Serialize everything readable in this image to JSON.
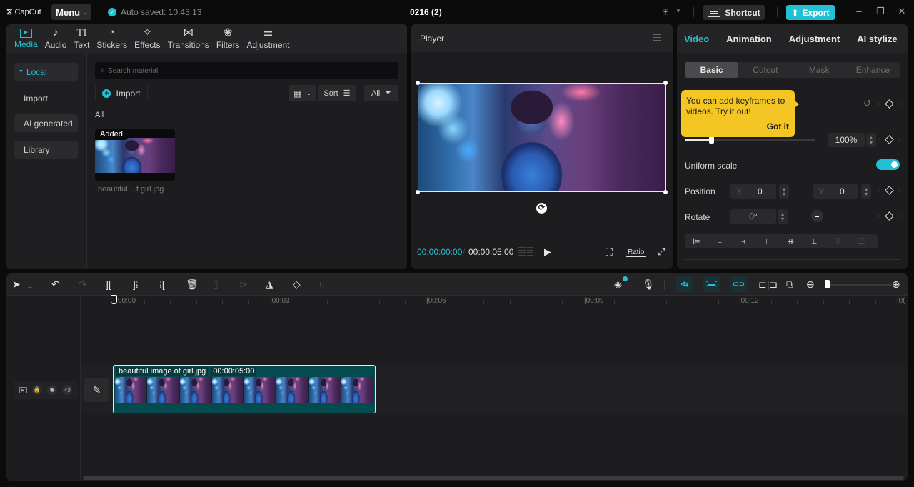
{
  "titlebar": {
    "app_name": "CapCut",
    "menu_label": "Menu",
    "auto_saved": "Auto saved: 10:43:13",
    "project_title": "0216 (2)",
    "shortcut_label": "Shortcut",
    "export_label": "Export",
    "icons": {
      "logo": "capcut-logo-icon",
      "saved": "check-circle-icon",
      "layout": "layout-icon",
      "keyboard": "keyboard-icon",
      "export": "upload-icon",
      "minimize": "minimize-icon",
      "maximize": "restore-icon",
      "close": "close-icon"
    }
  },
  "media": {
    "tabs": [
      {
        "label": "Media",
        "icon": "▶",
        "active": true
      },
      {
        "label": "Audio",
        "icon": "♪"
      },
      {
        "label": "Text",
        "icon": "TI"
      },
      {
        "label": "Stickers",
        "icon": "◔"
      },
      {
        "label": "Effects",
        "icon": "✧"
      },
      {
        "label": "Transitions",
        "icon": "⋈"
      },
      {
        "label": "Filters",
        "icon": "❀"
      },
      {
        "label": "Adjustment",
        "icon": "⚌"
      }
    ],
    "sidebar": [
      {
        "label": "Local",
        "active": true
      },
      {
        "label": "Import"
      },
      {
        "label": "AI generated"
      },
      {
        "label": "Library"
      }
    ],
    "search_placeholder": "Search material",
    "import_label": "Import",
    "sort_label": "Sort",
    "filter_label": "All",
    "section_label": "All",
    "items": [
      {
        "badge": "Added",
        "name": "beautiful ...f girl.jpg"
      }
    ]
  },
  "player": {
    "title": "Player",
    "current_time": "00:00:00:00",
    "total_time": "00:00:05:00",
    "ratio_label": "Ratio"
  },
  "properties": {
    "tabs": [
      "Video",
      "Animation",
      "Adjustment",
      "AI stylize"
    ],
    "active_tab": "Video",
    "subtabs": [
      "Basic",
      "Cutout",
      "Mask",
      "Enhance"
    ],
    "active_subtab": "Basic",
    "tooltip": {
      "text": "You can add keyframes to videos. Try it out!",
      "button": "Got it"
    },
    "scale": {
      "value": "100%",
      "slider_fraction": 0.2
    },
    "uniform_scale": {
      "label": "Uniform scale",
      "enabled": true
    },
    "position": {
      "label": "Position",
      "x_label": "X",
      "x": "0",
      "y_label": "Y",
      "y": "0"
    },
    "rotate": {
      "label": "Rotate",
      "value": "0°"
    }
  },
  "timeline": {
    "ruler_labels": [
      "00:00",
      "|00:03",
      "|00:06",
      "|00:09",
      "|00:12",
      "|0("
    ],
    "clip": {
      "name": "beautiful image of girl.jpg",
      "duration": "00:00:05:00"
    },
    "zoom_fraction": 0.05
  },
  "colors": {
    "accent": "#22c0d2",
    "tooltip": "#f4c623",
    "clip": "#054a4e",
    "panel": "#1d1d1f"
  }
}
